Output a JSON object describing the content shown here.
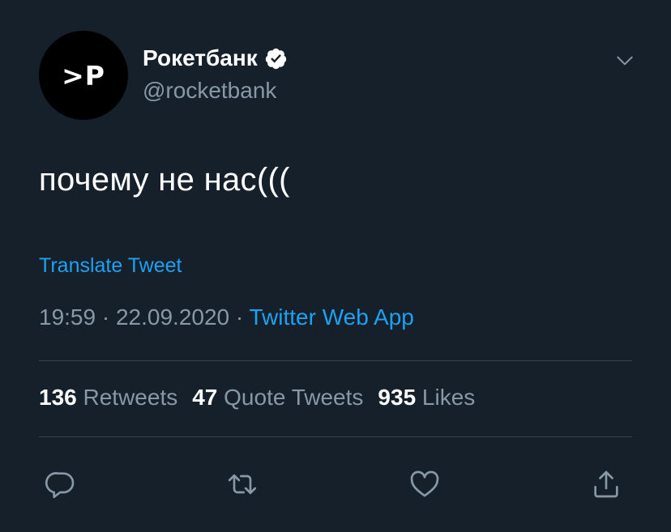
{
  "author": {
    "avatar_text": ">P",
    "display_name": "Рокетбанк",
    "handle": "@rocketbank",
    "verified": true,
    "avatar_bg": "#000000"
  },
  "tweet": {
    "text": "почему не нас(((",
    "translate_label": "Translate Tweet",
    "time": "19:59",
    "separator": "·",
    "date": "22.09.2020",
    "source": "Twitter Web App"
  },
  "stats": {
    "retweets_count": "136",
    "retweets_label": "Retweets",
    "quotes_count": "47",
    "quotes_label": "Quote Tweets",
    "likes_count": "935",
    "likes_label": "Likes"
  },
  "actions": [
    "reply-icon",
    "retweet-icon",
    "like-icon",
    "share-icon"
  ],
  "colors": {
    "background": "#15202b",
    "text_primary": "#ffffff",
    "text_secondary": "#8899a6",
    "accent": "#1da1f2",
    "divider": "#38444d"
  }
}
